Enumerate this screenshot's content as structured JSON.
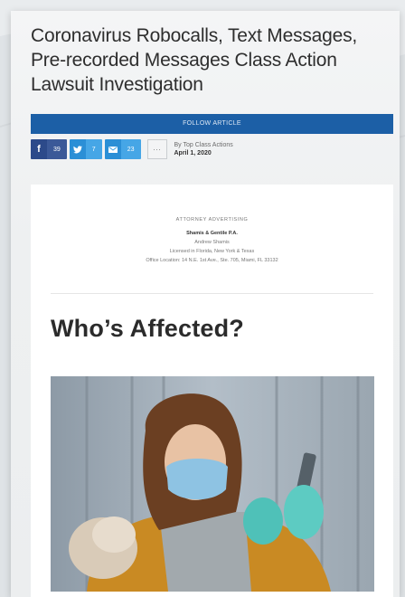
{
  "article": {
    "title": "Coronavirus Robocalls, Text Messages, Pre-recorded Messages Class Action Lawsuit Investigation",
    "follow_label": "FOLLOW ARTICLE"
  },
  "share": {
    "facebook": {
      "icon": "facebook-icon",
      "count": "39"
    },
    "twitter": {
      "icon": "twitter-icon",
      "count": "7"
    },
    "email": {
      "icon": "email-icon",
      "count": "23"
    },
    "more_icon": "ellipsis-icon"
  },
  "byline": {
    "author": "By Top Class Actions",
    "date": "April 1, 2020"
  },
  "advertising": {
    "header": "ATTORNEY ADVERTISING",
    "firm": "Shamis & Gentile P.A.",
    "attorney": "Andrew Shamis",
    "license": "Licensed in Florida, New York & Texas",
    "office": "Office Location: 14 N.E. 1st Ave., Ste. 705, Miami, FL 33132"
  },
  "section": {
    "heading": "Who’s Affected?"
  },
  "colors": {
    "follow_bar": "#1c5fa6",
    "facebook": "#3b5998",
    "twitter": "#46a6e6"
  }
}
